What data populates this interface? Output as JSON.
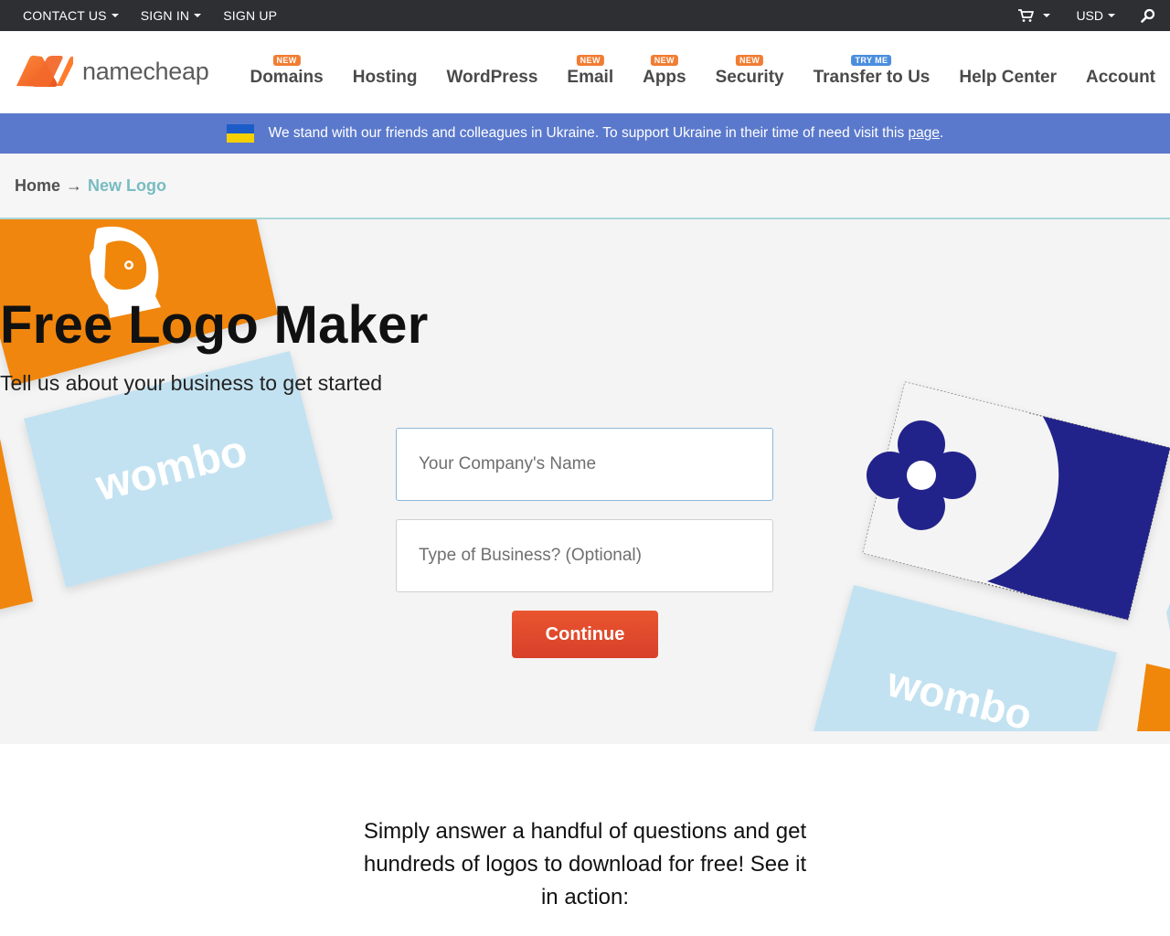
{
  "topbar": {
    "contact": "CONTACT US",
    "signin": "SIGN IN",
    "signup": "SIGN UP",
    "currency": "USD",
    "icons": [
      "cart-icon",
      "search-icon"
    ]
  },
  "header": {
    "logo_text": "namecheap",
    "nav": [
      {
        "label": "Domains",
        "badge": "NEW"
      },
      {
        "label": "Hosting",
        "badge": ""
      },
      {
        "label": "WordPress",
        "badge": ""
      },
      {
        "label": "Email",
        "badge": "NEW"
      },
      {
        "label": "Apps",
        "badge": "NEW"
      },
      {
        "label": "Security",
        "badge": "NEW"
      },
      {
        "label": "Transfer to Us",
        "badge": "TRY ME"
      },
      {
        "label": "Help Center",
        "badge": ""
      },
      {
        "label": "Account",
        "badge": ""
      }
    ]
  },
  "banner": {
    "text": "We stand with our friends and colleagues in Ukraine. To support Ukraine in their time of need visit this ",
    "link": "page",
    "end": "."
  },
  "breadcrumb": {
    "home": "Home",
    "arrow": "→",
    "current": "New Logo"
  },
  "hero": {
    "title": "Free Logo Maker",
    "subtitle": "Tell us about your business to get started",
    "company_placeholder": "Your Company's Name",
    "business_placeholder": "Type of Business? (Optional)",
    "continue": "Continue",
    "card_word_1": "wombo",
    "card_word_2": "wombo"
  },
  "lower": {
    "text": "Simply answer a handful of questions and get hundreds of logos to download for free! See it in action:"
  },
  "colors": {
    "topbar": "#2d2f32",
    "brand_orange": "#f27d32",
    "banner": "#5b79cc",
    "card_orange": "#f0860a",
    "card_blue": "#c3e2f1",
    "card_navy": "#22238a",
    "button": "#e0452a"
  }
}
